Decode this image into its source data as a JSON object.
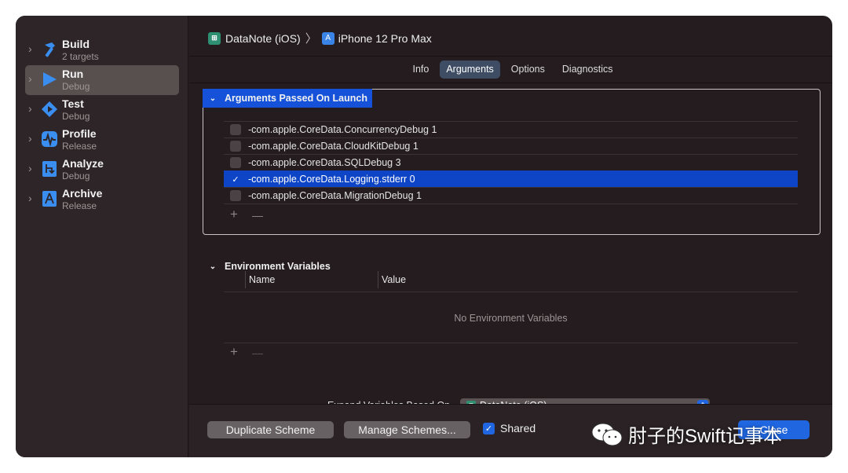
{
  "sidebar": {
    "items": [
      {
        "name": "Build",
        "sub": "2 targets",
        "icon": "hammer-icon",
        "color": "#3a8ef0"
      },
      {
        "name": "Run",
        "sub": "Debug",
        "icon": "play-icon",
        "color": "#3a8ef0"
      },
      {
        "name": "Test",
        "sub": "Debug",
        "icon": "diamond-play-icon",
        "color": "#3a8ef0"
      },
      {
        "name": "Profile",
        "sub": "Release",
        "icon": "waveform-icon",
        "color": "#3a8ef0"
      },
      {
        "name": "Analyze",
        "sub": "Debug",
        "icon": "analyze-icon",
        "color": "#3a8ef0"
      },
      {
        "name": "Archive",
        "sub": "Release",
        "icon": "archive-icon",
        "color": "#3a8ef0"
      }
    ],
    "selected_index": 1
  },
  "header": {
    "scheme": "DataNote (iOS)",
    "separator": "〉",
    "device": "iPhone 12 Pro Max"
  },
  "tabs": [
    {
      "label": "Info",
      "active": false
    },
    {
      "label": "Arguments",
      "active": true
    },
    {
      "label": "Options",
      "active": false
    },
    {
      "label": "Diagnostics",
      "active": false
    }
  ],
  "arguments": {
    "title": "Arguments Passed On Launch",
    "rows": [
      {
        "text": "-com.apple.CoreData.ConcurrencyDebug 1",
        "checked": false,
        "selected": false
      },
      {
        "text": "-com.apple.CoreData.CloudKitDebug 1",
        "checked": false,
        "selected": false
      },
      {
        "text": "-com.apple.CoreData.SQLDebug 3",
        "checked": false,
        "selected": false
      },
      {
        "text": "-com.apple.CoreData.Logging.stderr 0",
        "checked": true,
        "selected": true
      },
      {
        "text": "-com.apple.CoreData.MigrationDebug 1",
        "checked": false,
        "selected": false
      }
    ],
    "add": "+",
    "remove": "—"
  },
  "environment": {
    "title": "Environment Variables",
    "col_name": "Name",
    "col_value": "Value",
    "empty": "No Environment Variables",
    "add": "+",
    "remove": "—"
  },
  "expand": {
    "label": "Expand Variables Based On",
    "value": "DataNote (iOS)"
  },
  "footer": {
    "duplicate": "Duplicate Scheme",
    "manage": "Manage Schemes...",
    "shared_label": "Shared",
    "shared_checked": true,
    "close": "Close"
  },
  "watermark": {
    "text": "肘子的Swift记事本"
  },
  "colors": {
    "selection": "#0e45c6",
    "accent": "#1f66e0"
  }
}
